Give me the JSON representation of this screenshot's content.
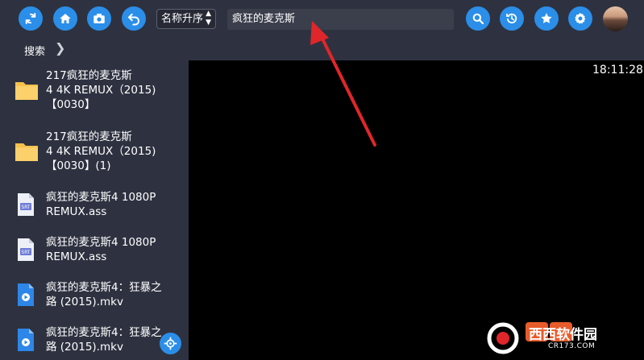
{
  "toolbar": {
    "sort_label": "名称升序",
    "search_value": "疯狂的麦克斯",
    "icons_left": [
      "refresh-icon",
      "home-icon",
      "camera-icon",
      "back-icon"
    ],
    "icons_right": [
      "search-icon",
      "history-icon",
      "star-icon",
      "gear-icon"
    ],
    "accent": "#2b8ee8"
  },
  "breadcrumb": {
    "label": "搜索"
  },
  "status": {
    "time": "18:11:28"
  },
  "files": [
    {
      "name": "217疯狂的麦克斯\n4  4K REMUX（2015)\n【0030】",
      "kind": "folder"
    },
    {
      "name": "217疯狂的麦克斯\n4  4K REMUX（2015)\n【0030】(1)",
      "kind": "folder"
    },
    {
      "name": "疯狂的麦克斯4  1080P\nREMUX.ass",
      "kind": "subtitle"
    },
    {
      "name": "疯狂的麦克斯4  1080P\nREMUX.ass",
      "kind": "subtitle"
    },
    {
      "name": "疯狂的麦克斯4：狂暴之\n路 (2015).mkv",
      "kind": "video"
    },
    {
      "name": "疯狂的麦克斯4：狂暴之\n路 (2015).mkv",
      "kind": "video"
    }
  ],
  "watermark": {
    "title": "西西软件园",
    "domain": "CR173.COM"
  }
}
